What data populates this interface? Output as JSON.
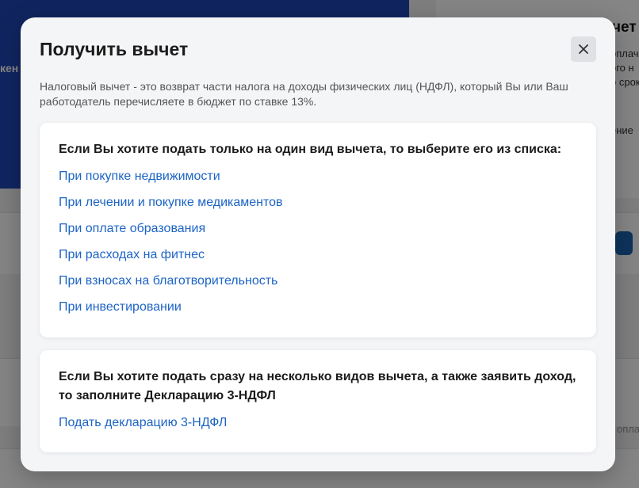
{
  "background": {
    "blue_fragment": "кен",
    "card_title_fragment": "чет",
    "card_lines": [
      "оплач",
      "ого н",
      "о срок",
      "ение"
    ],
    "side_text": "оплат"
  },
  "modal": {
    "title": "Получить вычет",
    "close_icon": "close-icon",
    "description": "Налоговый вычет - это возврат части налога на доходы физических лиц (НДФЛ), который Вы или Ваш работодатель перечисляете в бюджет по ставке 13%.",
    "single_section": {
      "heading": "Если Вы хотите подать только на один вид вычета, то выберите его из списка:",
      "links": [
        "При покупке недвижимости",
        "При лечении и покупке медикаментов",
        "При оплате образования",
        "При расходах на фитнес",
        "При взносах на благотворительность",
        "При инвестировании"
      ]
    },
    "multiple_section": {
      "heading": "Если Вы хотите подать сразу на несколько видов вычета, а также заявить доход, то заполните Декларацию 3-НДФЛ",
      "link": "Подать декларацию 3-НДФЛ"
    }
  },
  "colors": {
    "accent_link": "#1c64c4",
    "background_blue": "#1f47b8"
  }
}
